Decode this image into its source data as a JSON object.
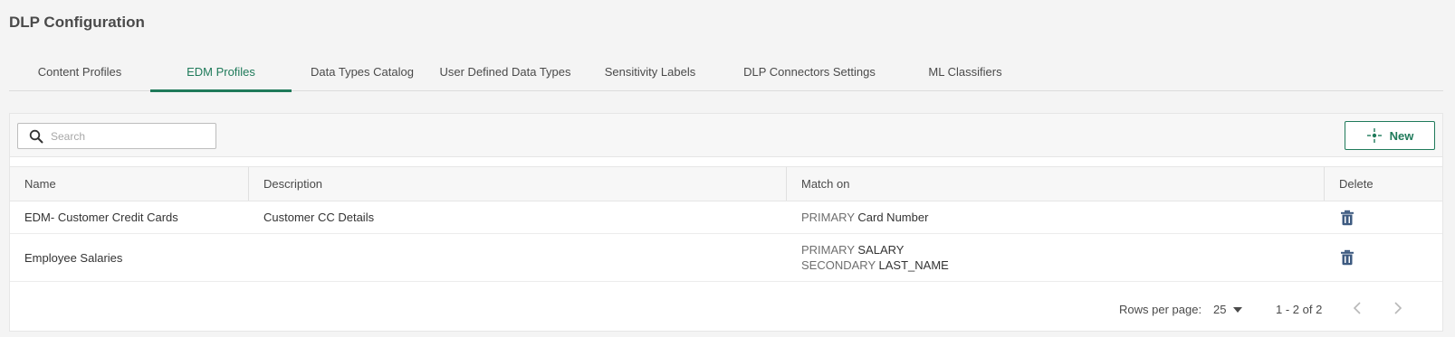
{
  "page": {
    "title": "DLP Configuration"
  },
  "tabs": [
    {
      "label": "Content Profiles",
      "active": false
    },
    {
      "label": "EDM Profiles",
      "active": true
    },
    {
      "label": "Data Types Catalog",
      "active": false
    },
    {
      "label": "User Defined Data Types",
      "active": false
    },
    {
      "label": "Sensitivity Labels",
      "active": false
    },
    {
      "label": "DLP Connectors Settings",
      "active": false
    },
    {
      "label": "ML Classifiers",
      "active": false
    }
  ],
  "toolbar": {
    "search_placeholder": "Search",
    "search_value": "",
    "new_label": "New",
    "search_icon": "search-icon",
    "new_icon": "crosshair-plus-icon"
  },
  "table": {
    "columns": {
      "name": "Name",
      "description": "Description",
      "match_on": "Match on",
      "delete": "Delete"
    },
    "rows": [
      {
        "name": "EDM- Customer Credit Cards",
        "description": "Customer CC Details",
        "match": [
          {
            "kind": "PRIMARY",
            "field": "Card Number"
          }
        ],
        "delete_icon": "trash-icon"
      },
      {
        "name": "Employee Salaries",
        "description": "",
        "match": [
          {
            "kind": "PRIMARY",
            "field": "SALARY"
          },
          {
            "kind": "SECONDARY",
            "field": "LAST_NAME"
          }
        ],
        "delete_icon": "trash-icon"
      }
    ]
  },
  "pagination": {
    "rows_per_page_label": "Rows per page:",
    "rows_per_page_value": "25",
    "range_text": "1 - 2 of 2"
  },
  "colors": {
    "accent": "#1f7a5a",
    "icon": "#3d5a80"
  }
}
